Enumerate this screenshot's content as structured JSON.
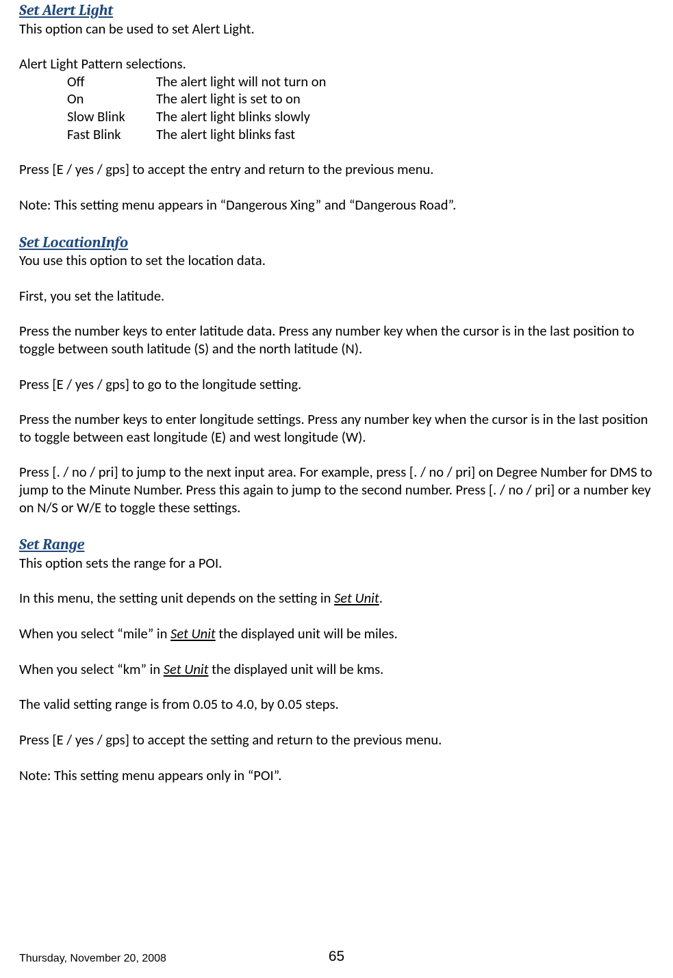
{
  "sections": {
    "alertLight": {
      "heading": "Set Alert Light",
      "intro": "This option can be used to set Alert Light.",
      "patternsHeading": "Alert Light Pattern selections.",
      "patterns": [
        {
          "key": "Off",
          "desc": "The alert light will not turn on"
        },
        {
          "key": "On",
          "desc": "The alert light is set to on"
        },
        {
          "key": "Slow Blink",
          "desc": "The alert light blinks slowly"
        },
        {
          "key": "Fast Blink",
          "desc": "The alert light blinks fast"
        }
      ],
      "accept": "Press [E / yes / gps] to accept the entry and return to the previous menu.",
      "note": "Note: This setting menu appears in “Dangerous Xing” and “Dangerous Road”."
    },
    "locationInfo": {
      "heading": "Set LocationInfo",
      "intro": "You use this option to set the location data.",
      "first": "First, you set the latitude.",
      "lat": "Press the number keys to enter latitude data. Press any number key when the cursor is in the last position to toggle between south latitude (S) and the north latitude (N).",
      "goLong": "Press [E / yes / gps] to go to the longitude setting.",
      "long": "Press the number keys to enter longitude settings. Press any number key when the cursor is in the last position to toggle between east longitude (E) and west longitude (W).",
      "jump": "Press [. / no / pri] to jump to the next input area. For example, press [. / no / pri] on Degree Number for DMS to jump to the Minute Number. Press this again to jump to the second number. Press [. / no / pri] or a number key on N/S or W/E to toggle these settings."
    },
    "range": {
      "heading": "Set Range",
      "intro": "This option sets the range for a POI.",
      "dep_pre": "In this menu, the setting unit depends on the setting in ",
      "dep_link": "Set Unit",
      "dep_post": ".",
      "mile_pre": "When you select “mile” in ",
      "mile_link": "Set Unit",
      "mile_post": " the displayed unit will be miles.",
      "km_pre": "When you select “km” in ",
      "km_link": "Set Unit",
      "km_post": " the displayed unit will be kms.",
      "valid": "The valid setting range is from 0.05 to 4.0, by 0.05 steps.",
      "accept": "Press [E / yes / gps] to accept the setting and return to the previous menu.",
      "note": "Note: This setting menu appears only in “POI”."
    }
  },
  "footer": {
    "date": "Thursday, November 20, 2008",
    "page": "65"
  }
}
